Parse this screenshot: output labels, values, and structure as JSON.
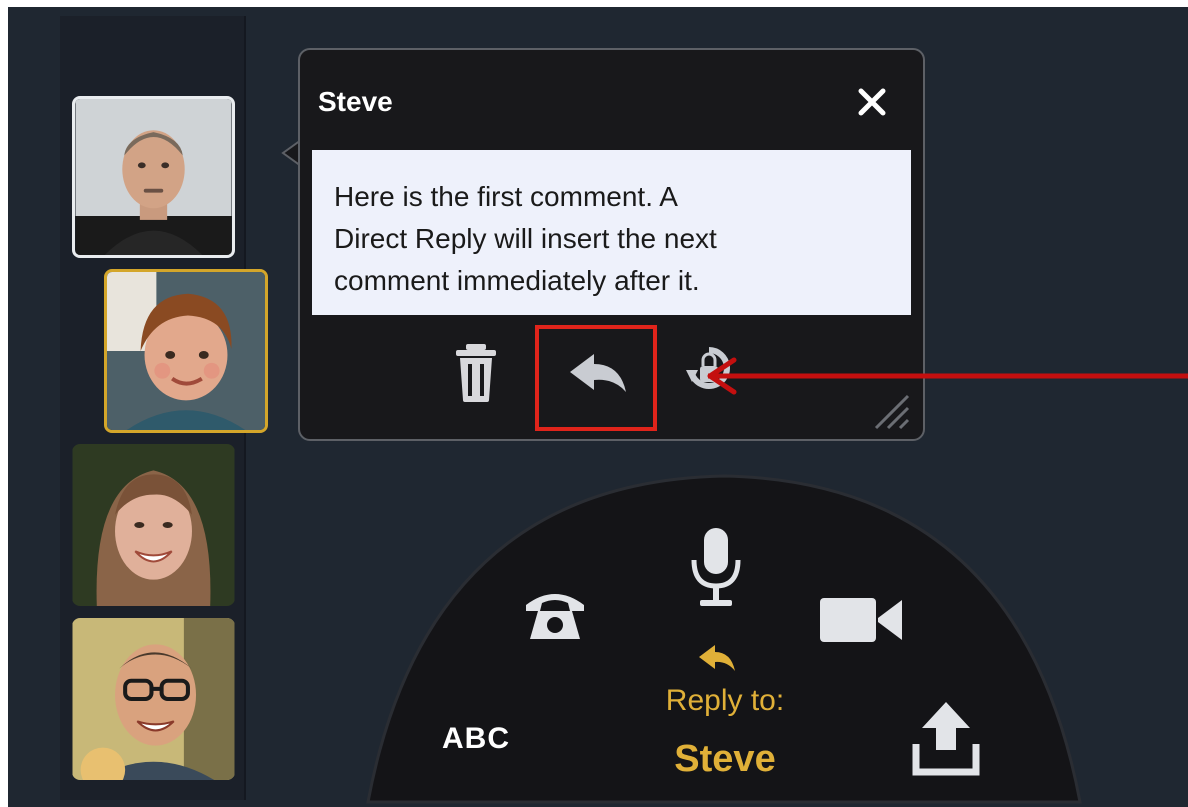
{
  "comment_popover": {
    "author": "Steve",
    "close_icon": "close-icon",
    "text_lines": [
      "Here is the first comment. A",
      "Direct Reply will insert the next",
      "comment immediately after it."
    ],
    "actions": {
      "delete_icon": "trash-icon",
      "reply_icon": "reply-arrow-icon",
      "rotate_icon": "rotate-lock-icon"
    }
  },
  "compose": {
    "abc_label": "ABC",
    "reply_to_label": "Reply to:",
    "reply_to_name": "Steve",
    "icons": [
      "phone-icon",
      "microphone-icon",
      "video-camera-icon",
      "upload-icon",
      "reply-arrow-icon"
    ]
  },
  "participants": [
    {
      "name": "Steve",
      "selected": false
    },
    {
      "name": "",
      "selected": true
    },
    {
      "name": "",
      "selected": false
    },
    {
      "name": "",
      "selected": false
    }
  ],
  "colors": {
    "background": "#1f2731",
    "popover": "#18181b",
    "comment_box": "#eef1fb",
    "accent_gold": "#e0b038",
    "highlight_red": "#e0241b",
    "arrow_red": "#c40f0f"
  }
}
